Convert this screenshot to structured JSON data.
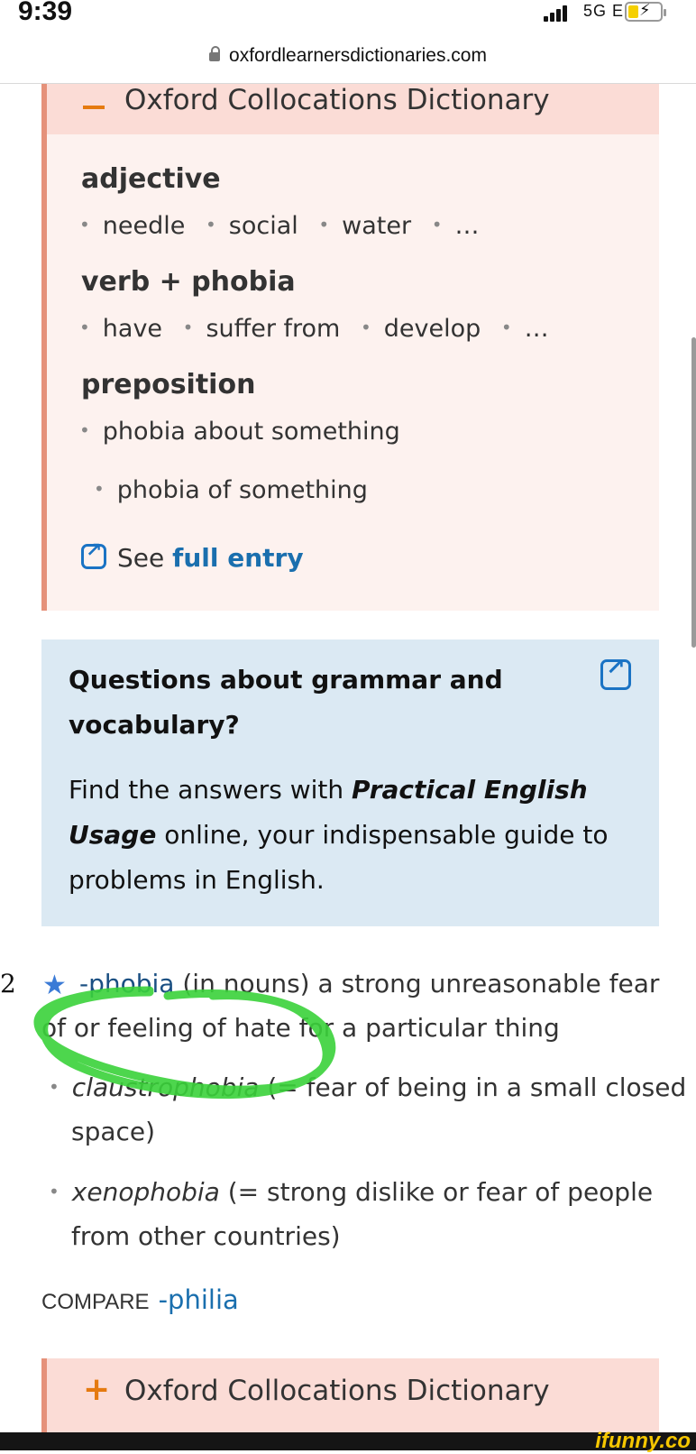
{
  "status_bar": {
    "time": "9:39",
    "network": "5G E"
  },
  "browser": {
    "url": "oxfordlearnersdictionaries.com"
  },
  "collocations_box": {
    "title": "Oxford Collocations Dictionary",
    "sections": [
      {
        "heading": "adjective",
        "items": [
          "needle",
          "social",
          "water",
          "…"
        ]
      },
      {
        "heading": "verb + phobia",
        "items": [
          "have",
          "suffer from",
          "develop",
          "…"
        ]
      },
      {
        "heading": "preposition",
        "items": [
          "phobia about something",
          "phobia of something"
        ]
      }
    ],
    "see_label": "See",
    "full_entry_link": "full entry"
  },
  "questions_box": {
    "title": "Questions about grammar and vocabulary?",
    "text_prefix": "Find the answers with ",
    "text_emph": "Practical English Usage",
    "text_suffix": " online, your indispensable guide to problems in English."
  },
  "definition": {
    "number": "2",
    "headword": "-phobia",
    "grammar": "(in nouns)",
    "text_line1": " a strong unreasonable fear",
    "text_line2": "of or feeling of hate for a particular thing",
    "examples": [
      {
        "term": "claustrophobia",
        "gloss_line1": " (= fear of being in a small closed",
        "gloss_line2": "space)"
      },
      {
        "term": "xenophobia",
        "gloss_line1": " (= strong dislike or fear of people",
        "gloss_line2": "from other countries)"
      }
    ],
    "compare_label": "COMPARE",
    "compare_link": "-philia"
  },
  "collocations_box_2": {
    "title": "Oxford Collocations Dictionary"
  },
  "watermark": "ifunny.co",
  "colors": {
    "accent_orange": "#e57a10",
    "link_blue": "#1a6fae",
    "collocation_bg": "#fdf2ef",
    "questions_bg": "#dbe9f3",
    "scribble_green": "#3ad13a"
  }
}
